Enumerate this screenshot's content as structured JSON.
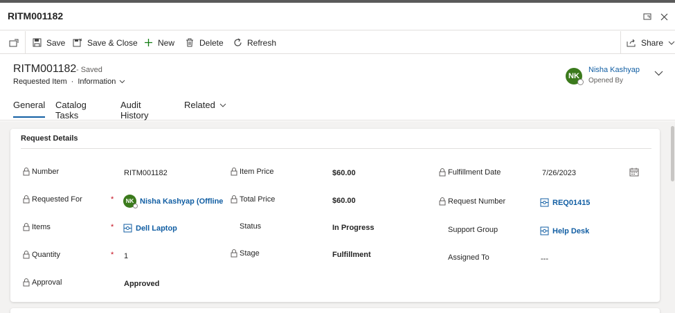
{
  "window": {
    "title": "RITM001182"
  },
  "toolbar": {
    "save": "Save",
    "save_close": "Save & Close",
    "new": "New",
    "delete": "Delete",
    "refresh": "Refresh",
    "share": "Share"
  },
  "header": {
    "record_title": "RITM001182",
    "status": "- Saved",
    "entity": "Requested Item",
    "separator": "·",
    "form": "Information",
    "owner_initials": "NK",
    "owner_name": "Nisha Kashyap",
    "owner_role": "Opened By"
  },
  "tabs": [
    {
      "label": "General"
    },
    {
      "label": "Catalog Tasks"
    },
    {
      "label": "Audit History"
    },
    {
      "label": "Related"
    }
  ],
  "section": {
    "title": "Request Details",
    "required_mark": "*",
    "fields": {
      "number": {
        "label": "Number",
        "value": "RITM001182"
      },
      "requested_for": {
        "label": "Requested For",
        "value": "Nisha Kashyap (Offline",
        "initials": "NK"
      },
      "items": {
        "label": "Items",
        "value": "Dell Laptop"
      },
      "quantity": {
        "label": "Quantity",
        "value": "1"
      },
      "approval": {
        "label": "Approval",
        "value": "Approved"
      },
      "item_price": {
        "label": "Item Price",
        "value": "$60.00"
      },
      "total_price": {
        "label": "Total Price",
        "value": "$60.00"
      },
      "status": {
        "label": "Status",
        "value": "In Progress"
      },
      "stage": {
        "label": "Stage",
        "value": "Fulfillment"
      },
      "fulfillment_date": {
        "label": "Fulfillment Date",
        "value": "7/26/2023"
      },
      "request_number": {
        "label": "Request Number",
        "value": "REQ01415"
      },
      "support_group": {
        "label": "Support Group",
        "value": "Help Desk"
      },
      "assigned_to": {
        "label": "Assigned To",
        "value": "---"
      }
    }
  },
  "colors": {
    "accent": "#115ea3",
    "avatar": "#3b7a1c",
    "required": "#c50f1f"
  }
}
